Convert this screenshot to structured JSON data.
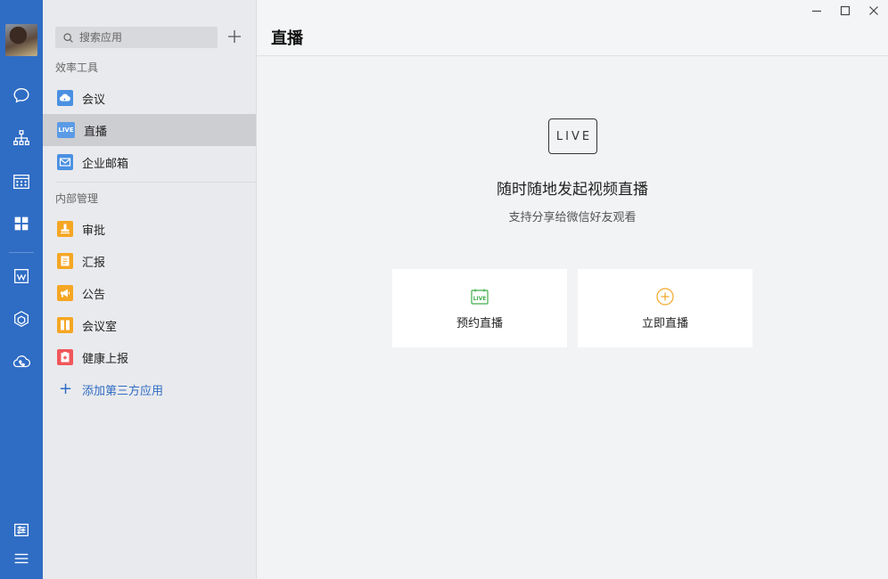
{
  "search": {
    "placeholder": "搜索应用"
  },
  "groups": [
    {
      "title": "效率工具"
    },
    {
      "title": "内部管理"
    }
  ],
  "apps": [
    {
      "label": "会议",
      "icon": "cloud-meeting-icon",
      "color": "#4a90e2"
    },
    {
      "label": "直播",
      "icon": "live-icon",
      "color": "#5b9be6",
      "icon_text": "LIVE",
      "active": true
    },
    {
      "label": "企业邮箱",
      "icon": "mail-icon",
      "color": "#4a90e2"
    },
    {
      "label": "审批",
      "icon": "stamp-icon",
      "color": "#f5a623"
    },
    {
      "label": "汇报",
      "icon": "report-icon",
      "color": "#f5a623"
    },
    {
      "label": "公告",
      "icon": "megaphone-icon",
      "color": "#f5a623"
    },
    {
      "label": "会议室",
      "icon": "meeting-room-icon",
      "color": "#f5a623"
    },
    {
      "label": "健康上报",
      "icon": "health-report-icon",
      "color": "#f0565a"
    }
  ],
  "add_third_party": {
    "label": "添加第三方应用"
  },
  "main": {
    "title": "直播",
    "badge": "LIVE",
    "headline": "随时随地发起视频直播",
    "subline": "支持分享给微信好友观看",
    "actions": [
      {
        "label": "预约直播",
        "icon": "calendar-live-icon",
        "color": "#3fae4a",
        "icon_text": "LIVE"
      },
      {
        "label": "立即直播",
        "icon": "plus-circle-icon",
        "color": "#f5a623"
      }
    ]
  },
  "rail": {
    "color": "#2f6cc4",
    "icons": [
      "chat-icon",
      "org-chart-icon",
      "calendar-icon",
      "apps-grid-icon",
      "doc-icon",
      "cube-icon",
      "cloud-phone-icon",
      "settings-icon",
      "menu-icon"
    ]
  },
  "window_controls": [
    "minimize-icon",
    "maximize-icon",
    "close-icon"
  ]
}
